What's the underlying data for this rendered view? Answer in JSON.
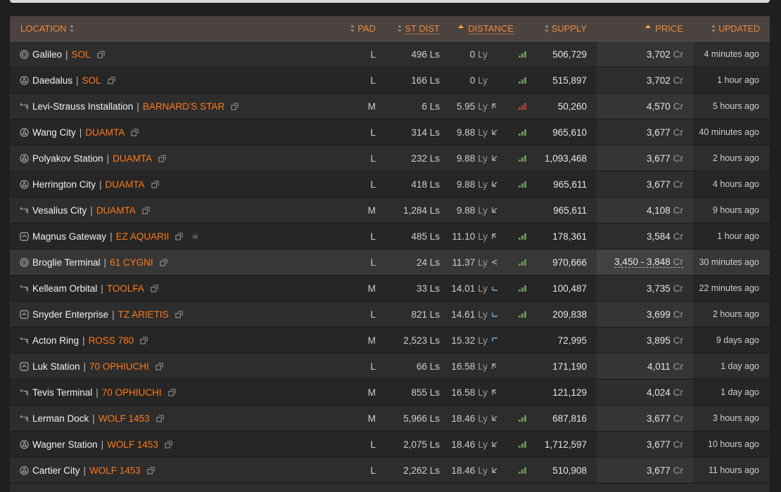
{
  "header": {
    "location": "LOCATION",
    "pad": "PAD",
    "st_dist": "ST DIST",
    "distance": "DISTANCE",
    "supply": "SUPPLY",
    "price": "PRICE",
    "updated": "UPDATED"
  },
  "rows": [
    {
      "icon": "orbis-icon",
      "station": "Galileo",
      "system": "SOL",
      "pad": "L",
      "st_dist": "496 Ls",
      "dist_value": "0",
      "dist_unit": "Ly",
      "direction": "",
      "supply": "506,729",
      "supply_level": "medium",
      "price": "3,702",
      "price_unit": "Cr",
      "updated": "4 minutes ago"
    },
    {
      "icon": "coriolis-icon",
      "station": "Daedalus",
      "system": "SOL",
      "pad": "L",
      "st_dist": "166 Ls",
      "dist_value": "0",
      "dist_unit": "Ly",
      "direction": "",
      "supply": "515,897",
      "supply_level": "medium",
      "price": "3,702",
      "price_unit": "Cr",
      "updated": "1 hour ago"
    },
    {
      "icon": "outpost-icon",
      "station": "Levi-Strauss Installation",
      "system": "BARNARD'S STAR",
      "pad": "M",
      "st_dist": "6 Ls",
      "dist_value": "5.95",
      "dist_unit": "Ly",
      "direction": "up-left",
      "supply": "50,260",
      "supply_level": "low",
      "price": "4,570",
      "price_unit": "Cr",
      "updated": "5 hours ago"
    },
    {
      "icon": "coriolis-icon",
      "station": "Wang City",
      "system": "DUAMTA",
      "pad": "L",
      "st_dist": "314 Ls",
      "dist_value": "9.88",
      "dist_unit": "Ly",
      "direction": "down-left",
      "supply": "965,610",
      "supply_level": "medium",
      "price": "3,677",
      "price_unit": "Cr",
      "updated": "40 minutes ago"
    },
    {
      "icon": "coriolis-icon",
      "station": "Polyakov Station",
      "system": "DUAMTA",
      "pad": "L",
      "st_dist": "232 Ls",
      "dist_value": "9.88",
      "dist_unit": "Ly",
      "direction": "down-left",
      "supply": "1,093,468",
      "supply_level": "medium",
      "price": "3,677",
      "price_unit": "Cr",
      "updated": "2 hours ago"
    },
    {
      "icon": "coriolis-icon",
      "station": "Herrington City",
      "system": "DUAMTA",
      "pad": "L",
      "st_dist": "418 Ls",
      "dist_value": "9.88",
      "dist_unit": "Ly",
      "direction": "down-left",
      "supply": "965,611",
      "supply_level": "medium",
      "price": "3,677",
      "price_unit": "Cr",
      "updated": "4 hours ago"
    },
    {
      "icon": "outpost-icon",
      "station": "Vesalius City",
      "system": "DUAMTA",
      "pad": "M",
      "st_dist": "1,284 Ls",
      "dist_value": "9.88",
      "dist_unit": "Ly",
      "direction": "down-left",
      "supply": "965,611",
      "supply_level": "none",
      "price": "4,108",
      "price_unit": "Cr",
      "updated": "9 hours ago"
    },
    {
      "icon": "asteroid-base-icon",
      "station": "Magnus Gateway",
      "system": "EZ AQUARII",
      "pad": "L",
      "st_dist": "485 Ls",
      "dist_value": "11.10",
      "dist_unit": "Ly",
      "direction": "up-left",
      "supply": "178,361",
      "supply_level": "medium",
      "price": "3,584",
      "price_unit": "Cr",
      "updated": "1 hour ago",
      "skull": "☠"
    },
    {
      "icon": "orbis-icon",
      "station": "Broglie Terminal",
      "system": "61 CYGNI",
      "pad": "L",
      "st_dist": "24 Ls",
      "dist_value": "11.37",
      "dist_unit": "Ly",
      "direction": "left",
      "supply": "970,666",
      "supply_level": "medium",
      "price": "3,450 - 3,848",
      "price_unit": "Cr",
      "updated": "30 minutes ago",
      "highlight": true
    },
    {
      "icon": "outpost-icon",
      "station": "Kelleam Orbital",
      "system": "TOOLFA",
      "pad": "M",
      "st_dist": "33 Ls",
      "dist_value": "14.01",
      "dist_unit": "Ly",
      "direction": "down-right",
      "supply": "100,487",
      "supply_level": "medium",
      "price": "3,735",
      "price_unit": "Cr",
      "updated": "22 minutes ago"
    },
    {
      "icon": "asteroid-base-icon",
      "station": "Snyder Enterprise",
      "system": "TZ ARIETIS",
      "pad": "L",
      "st_dist": "821 Ls",
      "dist_value": "14.61",
      "dist_unit": "Ly",
      "direction": "down-right",
      "supply": "209,838",
      "supply_level": "medium",
      "price": "3,699",
      "price_unit": "Cr",
      "updated": "2 hours ago"
    },
    {
      "icon": "outpost-icon",
      "station": "Acton Ring",
      "system": "ROSS 780",
      "pad": "M",
      "st_dist": "2,523 Ls",
      "dist_value": "15.32",
      "dist_unit": "Ly",
      "direction": "up-right",
      "supply": "72,995",
      "supply_level": "none",
      "price": "3,895",
      "price_unit": "Cr",
      "updated": "9 days ago"
    },
    {
      "icon": "asteroid-base-icon",
      "station": "Luk Station",
      "system": "70 OPHIUCHI",
      "pad": "L",
      "st_dist": "66 Ls",
      "dist_value": "16.58",
      "dist_unit": "Ly",
      "direction": "up-left",
      "supply": "171,190",
      "supply_level": "none",
      "price": "4,011",
      "price_unit": "Cr",
      "updated": "1 day ago"
    },
    {
      "icon": "outpost-icon",
      "station": "Tevis Terminal",
      "system": "70 OPHIUCHI",
      "pad": "M",
      "st_dist": "855 Ls",
      "dist_value": "16.58",
      "dist_unit": "Ly",
      "direction": "up-left",
      "supply": "121,129",
      "supply_level": "none",
      "price": "4,024",
      "price_unit": "Cr",
      "updated": "1 day ago"
    },
    {
      "icon": "outpost-icon",
      "station": "Lerman Dock",
      "system": "WOLF 1453",
      "pad": "M",
      "st_dist": "5,966 Ls",
      "dist_value": "18.46",
      "dist_unit": "Ly",
      "direction": "down-left",
      "supply": "687,816",
      "supply_level": "medium",
      "price": "3,677",
      "price_unit": "Cr",
      "updated": "3 hours ago"
    },
    {
      "icon": "coriolis-icon",
      "station": "Wagner Station",
      "system": "WOLF 1453",
      "pad": "L",
      "st_dist": "2,075 Ls",
      "dist_value": "18.46",
      "dist_unit": "Ly",
      "direction": "down-left",
      "supply": "1,712,597",
      "supply_level": "medium",
      "price": "3,677",
      "price_unit": "Cr",
      "updated": "10 hours ago"
    },
    {
      "icon": "coriolis-icon",
      "station": "Cartier City",
      "system": "WOLF 1453",
      "pad": "L",
      "st_dist": "2,262 Ls",
      "dist_value": "18.46",
      "dist_unit": "Ly",
      "direction": "down-left",
      "supply": "510,908",
      "supply_level": "medium",
      "price": "3,677",
      "price_unit": "Cr",
      "updated": "11 hours ago"
    }
  ],
  "colors": {
    "accent": "#f08a3a",
    "system": "#ff7a1a",
    "supply_bar": "#6a8f55",
    "supply_low": "#d05040"
  }
}
